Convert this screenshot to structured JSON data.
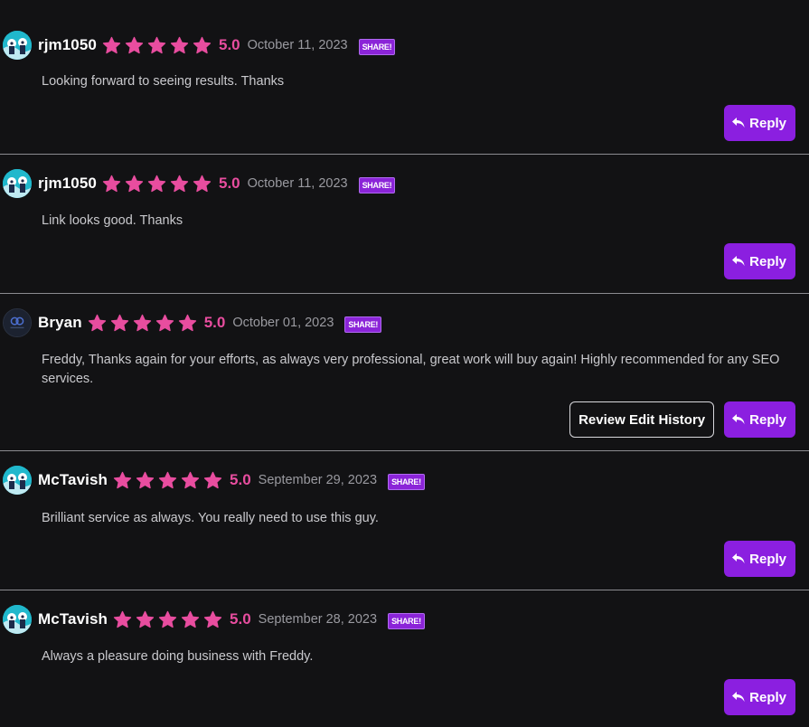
{
  "colors": {
    "background": "#121214",
    "star": "#e84d9f",
    "rating": "#e84d9f",
    "accent": "#8b1fe0",
    "divider": "#8b8b90"
  },
  "reviews": [
    {
      "username": "rjm1050",
      "avatar": "teal-character-avatar",
      "stars": 5,
      "rating": "5.0",
      "date": "October 11, 2023",
      "share_label": "SHARE!",
      "text": "Looking forward to seeing results. Thanks",
      "reply_label": "Reply",
      "history_label": ""
    },
    {
      "username": "rjm1050",
      "avatar": "teal-character-avatar",
      "stars": 5,
      "rating": "5.0",
      "date": "October 11, 2023",
      "share_label": "SHARE!",
      "text": "Link looks good. Thanks",
      "reply_label": "Reply",
      "history_label": ""
    },
    {
      "username": "Bryan",
      "avatar": "dark-logo-avatar",
      "stars": 5,
      "rating": "5.0",
      "date": "October 01, 2023",
      "share_label": "SHARE!",
      "text": "Freddy, Thanks again for your efforts, as always very professional, great work will buy again! Highly recommended for any SEO services.",
      "reply_label": "Reply",
      "history_label": "Review Edit History"
    },
    {
      "username": "McTavish",
      "avatar": "teal-character-avatar",
      "stars": 5,
      "rating": "5.0",
      "date": "September 29, 2023",
      "share_label": "SHARE!",
      "text": "Brilliant service as always. You really need to use this guy.",
      "reply_label": "Reply",
      "history_label": ""
    },
    {
      "username": "McTavish",
      "avatar": "teal-character-avatar",
      "stars": 5,
      "rating": "5.0",
      "date": "September 28, 2023",
      "share_label": "SHARE!",
      "text": "Always a pleasure doing business with Freddy.",
      "reply_label": "Reply",
      "history_label": ""
    }
  ]
}
